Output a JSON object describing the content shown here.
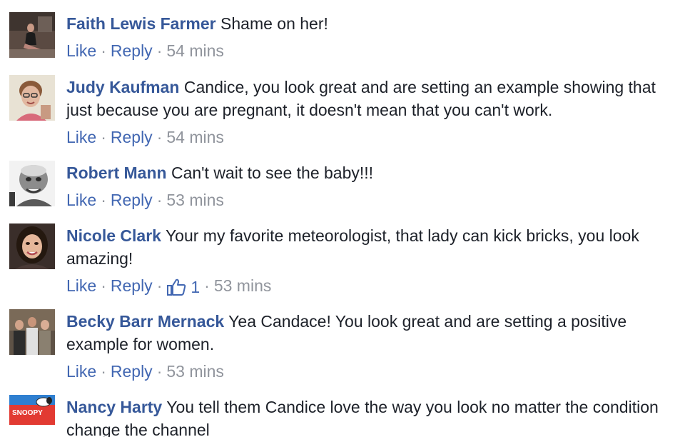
{
  "comments": [
    {
      "author": "Faith Lewis Farmer",
      "text": "Shame on her!",
      "like_label": "Like",
      "reply_label": "Reply",
      "time": "54 mins"
    },
    {
      "author": "Judy Kaufman",
      "text": "Candice, you look great and are setting an example showing that just because you are pregnant, it doesn't mean that you can't work.",
      "like_label": "Like",
      "reply_label": "Reply",
      "time": "54 mins"
    },
    {
      "author": "Robert Mann",
      "text": "Can't wait to see the baby!!!",
      "like_label": "Like",
      "reply_label": "Reply",
      "time": "53 mins"
    },
    {
      "author": "Nicole Clark",
      "text": "Your my favorite meteorologist, that lady can kick bricks, you look amazing!",
      "like_label": "Like",
      "reply_label": "Reply",
      "reaction_count": "1",
      "time": "53 mins"
    },
    {
      "author": "Becky Barr Mernack",
      "text": "Yea Candace! You look great and are setting a positive example for women.",
      "like_label": "Like",
      "reply_label": "Reply",
      "time": "53 mins"
    },
    {
      "author": "Nancy Harty",
      "text": "You tell them Candice love the way you look no matter the condition change the channel",
      "avatar_text": "SNOOPY"
    }
  ],
  "separator": "·",
  "colors": {
    "author": "#365899",
    "link": "#4267b2",
    "meta": "#90949c",
    "text": "#1d2129"
  }
}
